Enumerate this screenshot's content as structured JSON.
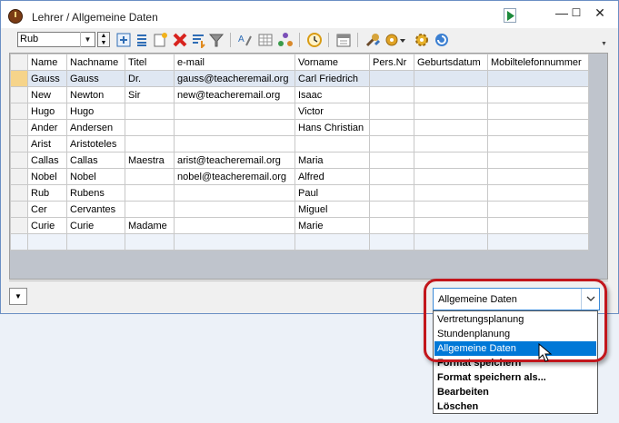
{
  "window": {
    "title": "Lehrer / Allgemeine Daten",
    "minimize_glyph": "—",
    "maximize_glyph": "☐",
    "close_glyph": "✕"
  },
  "toolbar": {
    "filter_value": "Rub",
    "icons": [
      "new-record-icon",
      "list-view-icon",
      "new-sheet-icon",
      "delete-icon",
      "sort-icon",
      "filter-icon",
      "spell-check-icon",
      "grid-settings-icon",
      "tree-icon",
      "clock-icon",
      "calendar-icon",
      "tools-icon",
      "settings-dropdown-icon",
      "gear-icon",
      "refresh-icon"
    ]
  },
  "grid": {
    "columns": [
      "Name",
      "Nachname",
      "Titel",
      "e-mail",
      "Vorname",
      "Pers.Nr",
      "Geburtsdatum",
      "Mobiltelefonnummer"
    ],
    "rows": [
      [
        "Gauss",
        "Gauss",
        "Dr.",
        "gauss@teacheremail.org",
        "Carl Friedrich",
        "",
        "",
        ""
      ],
      [
        "New",
        "Newton",
        "Sir",
        "new@teacheremail.org",
        "Isaac",
        "",
        "",
        ""
      ],
      [
        "Hugo",
        "Hugo",
        "",
        "",
        "Victor",
        "",
        "",
        ""
      ],
      [
        "Ander",
        "Andersen",
        "",
        "",
        "Hans Christian",
        "",
        "",
        ""
      ],
      [
        "Arist",
        "Aristoteles",
        "",
        "",
        "",
        "",
        "",
        ""
      ],
      [
        "Callas",
        "Callas",
        "Maestra",
        "arist@teacheremail.org",
        "Maria",
        "",
        "",
        ""
      ],
      [
        "Nobel",
        "Nobel",
        "",
        "nobel@teacheremail.org",
        "Alfred",
        "",
        "",
        ""
      ],
      [
        "Rub",
        "Rubens",
        "",
        "",
        "Paul",
        "",
        "",
        ""
      ],
      [
        "Cer",
        "Cervantes",
        "",
        "",
        "Miguel",
        "",
        "",
        ""
      ],
      [
        "Curie",
        "Curie",
        "Madame",
        "",
        "Marie",
        "",
        "",
        ""
      ]
    ],
    "selected_row": 0
  },
  "view_selector": {
    "value": "Allgemeine Daten",
    "options": [
      {
        "label": "Vertretungsplanung",
        "selected": false,
        "bold": false
      },
      {
        "label": "Stundenplanung",
        "selected": false,
        "bold": false
      },
      {
        "label": "Allgemeine Daten",
        "selected": true,
        "bold": false
      },
      {
        "label": "Format speichern",
        "selected": false,
        "bold": true
      },
      {
        "label": "Format speichern als...",
        "selected": false,
        "bold": true
      },
      {
        "label": "Bearbeiten",
        "selected": false,
        "bold": true
      },
      {
        "label": "Löschen",
        "selected": false,
        "bold": true
      }
    ]
  },
  "colors": {
    "accent": "#0078d7",
    "highlight_ring": "#c2161c",
    "selected_row_header": "#f6d48a"
  }
}
